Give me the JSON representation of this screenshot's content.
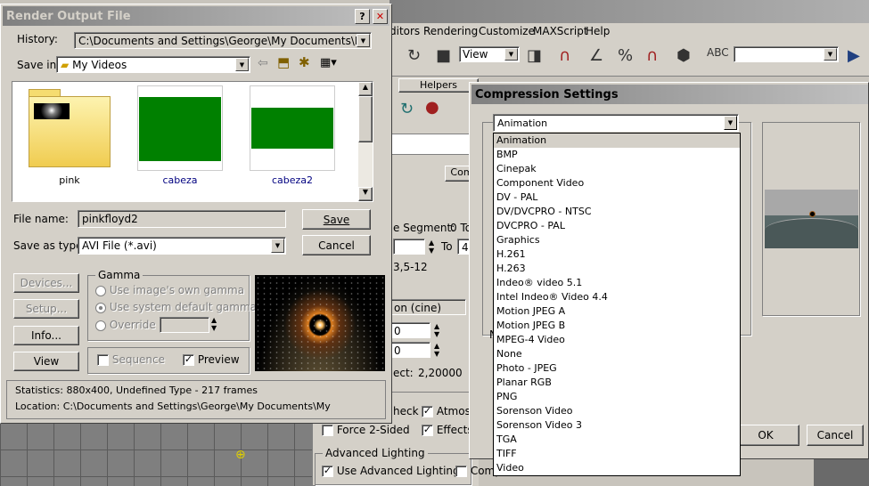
{
  "max": {
    "menu": [
      "ditors",
      "Rendering",
      "Customize",
      "MAXScript",
      "Help"
    ],
    "view_dropdown": "View",
    "tab_helpers": "Helpers",
    "tab_com": "Com",
    "labels": {
      "segment": "e Segment:",
      "to_a": "0 To",
      "to_b": "To",
      "frames": "3,5-12",
      "cine": "on (cine)",
      "aspect": "ect:",
      "aspect_val": "2,20000",
      "check": "heck",
      "atmos": "Atmosp",
      "force": "Force 2-Sided",
      "effects": "Effects",
      "adv": "Advanced Lighting",
      "use_adv": "Use Advanced Lighting",
      "comp": "Comp",
      "seg_val": "4",
      "n": "N"
    }
  },
  "render": {
    "title": "Render Output File",
    "history_label": "History:",
    "history_value": "C:\\Documents and Settings\\George\\My Documents\\My Videos",
    "savein_label": "Save in:",
    "savein_value": "My Videos",
    "files": [
      {
        "name": "pink",
        "kind": "folder"
      },
      {
        "name": "cabeza",
        "kind": "image"
      },
      {
        "name": "cabeza2",
        "kind": "image"
      }
    ],
    "filename_label": "File name:",
    "filename_value": "pinkfloyd2",
    "saveas_label": "Save as type:",
    "saveas_value": "AVI File (*.avi)",
    "save_btn": "Save",
    "cancel_btn": "Cancel",
    "devices_btn": "Devices...",
    "setup_btn": "Setup...",
    "info_btn": "Info...",
    "view_btn": "View",
    "gamma": {
      "title": "Gamma",
      "opt1": "Use image's own gamma",
      "opt2": "Use system default gamma",
      "opt3": "Override"
    },
    "sequence": "Sequence",
    "preview": "Preview",
    "statistics": "Statistics:  880x400, Undefined Type - 217 frames",
    "location": "Location:  C:\\Documents and Settings\\George\\My Documents\\My"
  },
  "compression": {
    "title": "Compression Settings",
    "selected": "Animation",
    "options": [
      "Animation",
      "BMP",
      "Cinepak",
      "Component Video",
      "DV - PAL",
      "DV/DVCPRO - NTSC",
      "DVCPRO - PAL",
      "Graphics",
      "H.261",
      "H.263",
      "Indeo® video 5.1",
      "Intel Indeo® Video 4.4",
      "Motion JPEG A",
      "Motion JPEG B",
      "MPEG-4 Video",
      "None",
      "Photo - JPEG",
      "Planar RGB",
      "PNG",
      "Sorenson Video",
      "Sorenson Video 3",
      "TGA",
      "TIFF",
      "Video"
    ],
    "ok_btn": "OK",
    "cancel_btn": "Cancel"
  }
}
